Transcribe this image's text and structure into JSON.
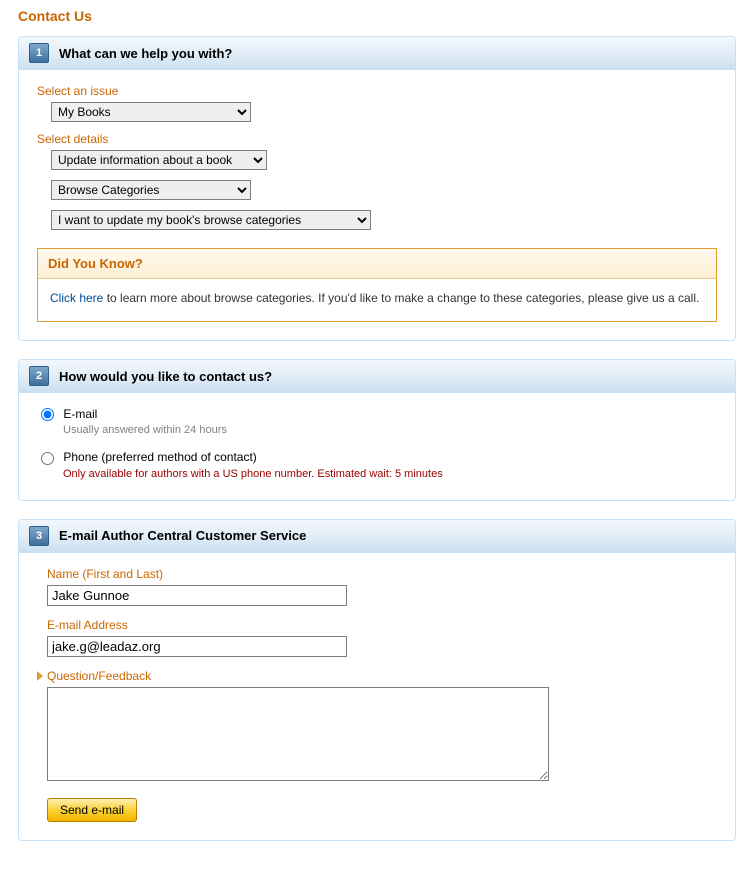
{
  "page": {
    "title": "Contact Us"
  },
  "step1": {
    "num": "1",
    "title": "What can we help you with?",
    "select_issue_label": "Select an issue",
    "issue_value": "My Books",
    "select_details_label": "Select details",
    "detail1_value": "Update information about a book",
    "detail2_value": "Browse Categories",
    "detail3_value": "I want to update my book's browse categories",
    "info_title": "Did You Know?",
    "info_link": "Click here",
    "info_text_after": " to learn more about browse categories. If you'd like to make a change to these categories, please give us a call."
  },
  "step2": {
    "num": "2",
    "title": "How would you like to contact us?",
    "email_label": "E-mail",
    "email_sub": "Usually answered within 24 hours",
    "phone_label": "Phone (preferred method of contact)",
    "phone_sub": "Only available for authors with a US phone number. Estimated wait: 5 minutes"
  },
  "step3": {
    "num": "3",
    "title": "E-mail Author Central Customer Service",
    "name_label": "Name (First and Last)",
    "name_value": "Jake Gunnoe",
    "email_label": "E-mail Address",
    "email_value": "jake.g@leadaz.org",
    "question_label": "Question/Feedback",
    "question_value": "",
    "send_label": "Send e-mail"
  }
}
